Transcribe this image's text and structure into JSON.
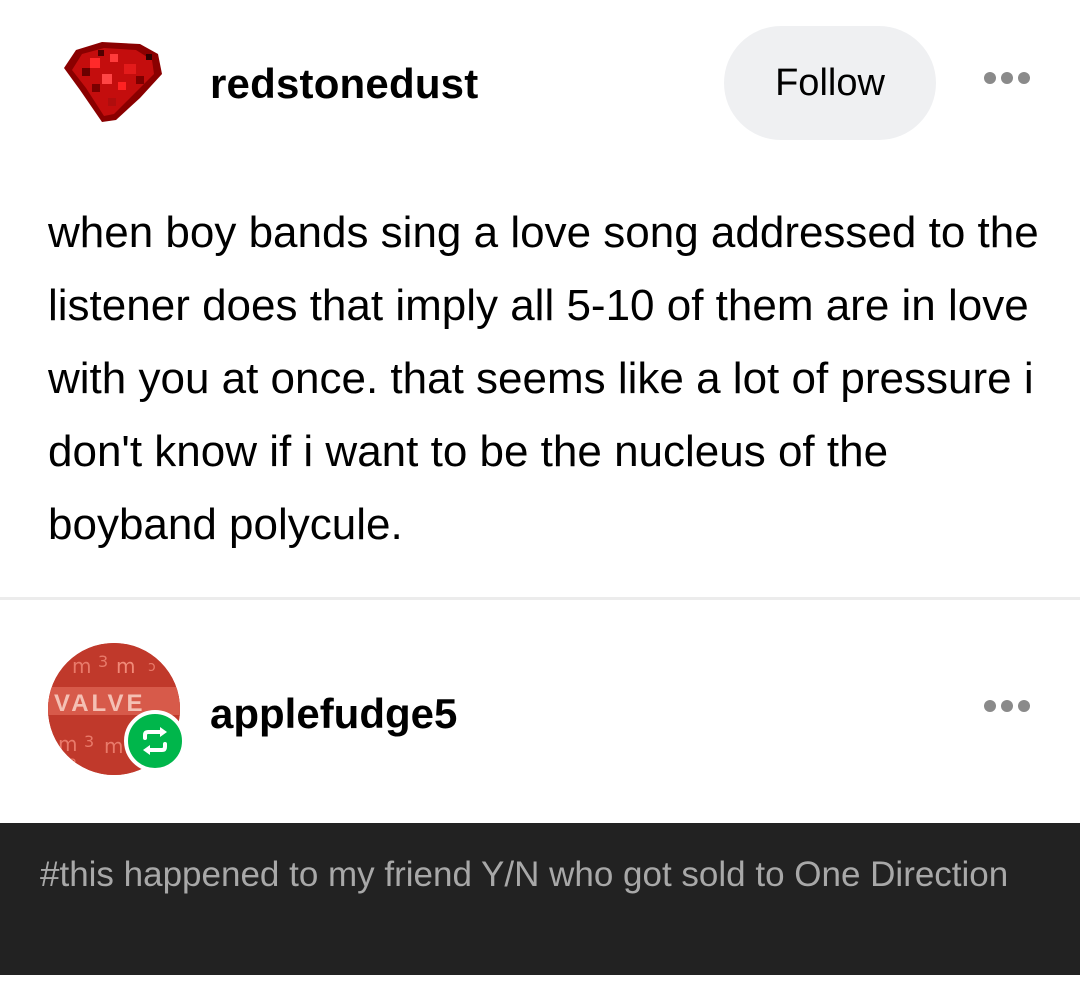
{
  "post": {
    "username": "redstonedust",
    "follow_label": "Follow",
    "body": "when boy bands sing a love song addressed to the listener does that imply all 5-10 of them are in love with you at once. that seems like a lot of pressure i don't know if i want to be the nucleus of the boyband polycule.",
    "avatar_icon": "redstone-dust-icon",
    "avatar_color": "#c01010"
  },
  "reblog": {
    "username": "applefudge5",
    "avatar_text": "VALVE",
    "avatar_icon": "valve-logo-icon",
    "badge_icon": "reblog-icon",
    "badge_color": "#00b64b",
    "tags": "#this happened to my friend Y/N who got sold to One Direction"
  },
  "theme": {
    "follow_bg": "#eff0f2",
    "tags_bg": "#222222",
    "tags_color": "#a8a8a8"
  }
}
